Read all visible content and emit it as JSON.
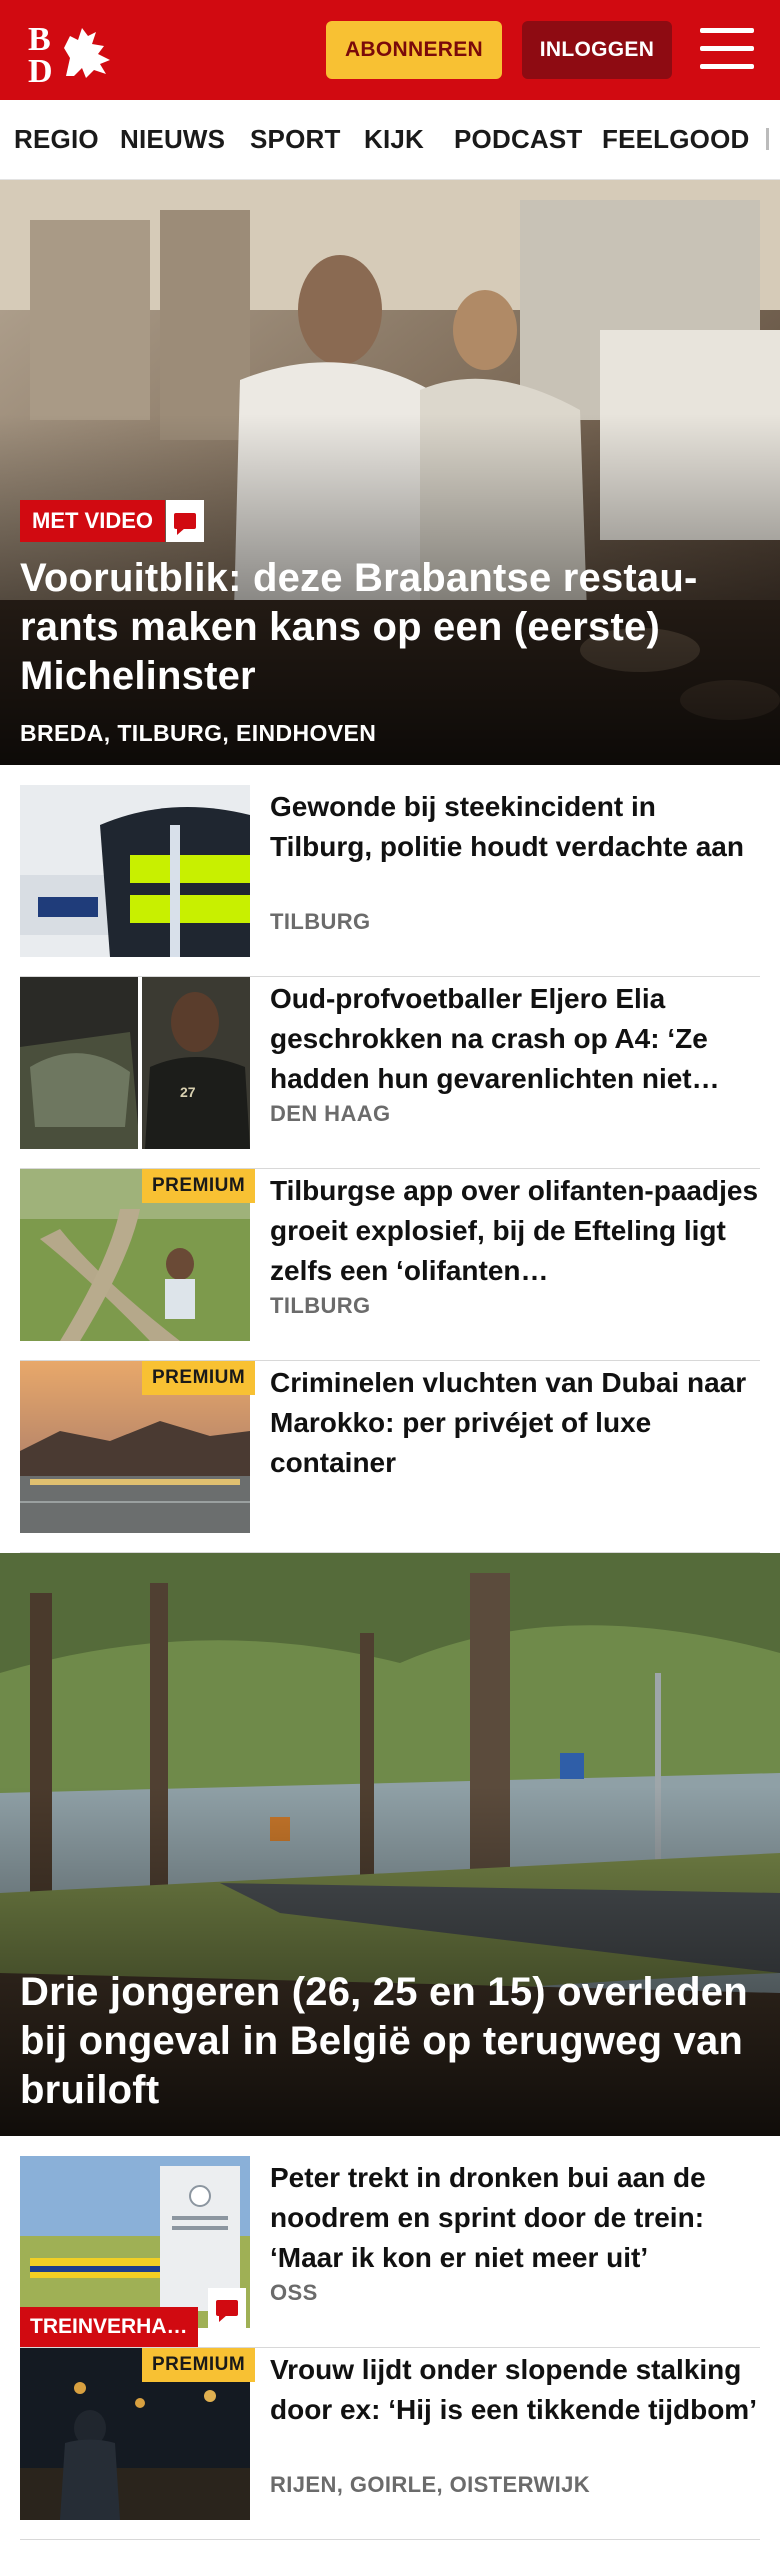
{
  "header": {
    "logo_text": "BD",
    "subscribe_label": "ABONNEREN",
    "login_label": "INLOGGEN",
    "brand_color": "#d10a11",
    "accent_color": "#f8c133"
  },
  "nav": {
    "items": [
      "REGIO",
      "NIEUWS",
      "SPORT",
      "KIJK",
      "PODCAST",
      "FEELGOOD"
    ]
  },
  "hero1": {
    "badge": "MET VIDEO",
    "title": "Vooruitblik: deze Brabantse restaurants maken kans op een (eerste) Michelinster",
    "title_display": "Vooruitblik: deze Brabantse restau-rants maken kans op een (eerste) Michelinster",
    "location": "BREDA, TILBURG, EINDHOVEN"
  },
  "articles": [
    {
      "title": "Gewonde bij steekincident in Tilburg, politie houdt verdachte aan",
      "location": "TILBURG",
      "premium": ""
    },
    {
      "title": "Oud-profvoetballer Eljero Elia geschrokken na crash op A4: ‘Ze hadden hun gevarenlichten niet…",
      "location": "DEN HAAG",
      "premium": ""
    },
    {
      "title": "Tilburgse app over olifanten-paadjes groeit explosief, bij de Efteling ligt zelfs een ‘olifanten…",
      "location": "TILBURG",
      "premium": "PREMIUM"
    },
    {
      "title": "Criminelen vluchten van Dubai naar Marokko: per privéjet of luxe container",
      "location": "",
      "premium": "PREMIUM"
    }
  ],
  "hero2": {
    "title": "Drie jongeren (26, 25 en 15) overleden bij ongeval in België op terugweg van bruiloft"
  },
  "articles2": [
    {
      "title": "Peter trekt in dronken bui aan de noodrem en sprint door de trein: ‘Maar ik kon er niet meer uit’",
      "location": "OSS",
      "badge": "TREINVERHA…",
      "premium": ""
    },
    {
      "title": "Vrouw lijdt onder slopende stalking door ex: ‘Hij is een tikkende tijdbom’",
      "location": "RIJEN, GOIRLE, OISTERWIJK",
      "premium": "PREMIUM"
    }
  ]
}
